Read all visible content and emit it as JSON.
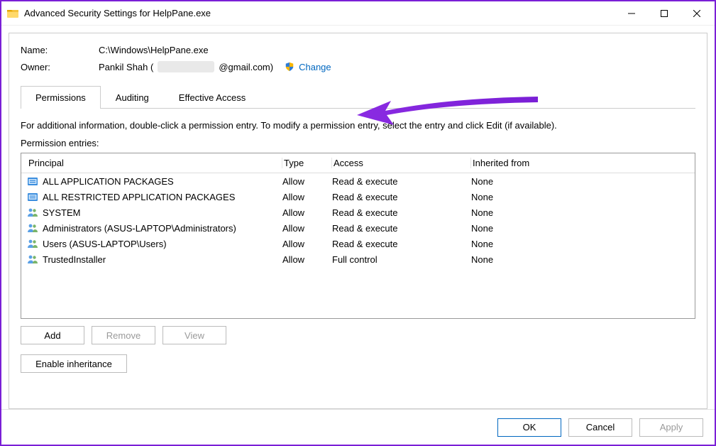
{
  "window": {
    "title": "Advanced Security Settings for HelpPane.exe"
  },
  "header": {
    "name_label": "Name:",
    "name_value": "C:\\Windows\\HelpPane.exe",
    "owner_label": "Owner:",
    "owner_prefix": "Pankil Shah (",
    "owner_suffix": "@gmail.com)",
    "change_label": "Change"
  },
  "tabs": {
    "permissions": "Permissions",
    "auditing": "Auditing",
    "effective": "Effective Access"
  },
  "info_text": "For additional information, double-click a permission entry. To modify a permission entry, select the entry and click Edit (if available).",
  "entries_label": "Permission entries:",
  "columns": {
    "principal": "Principal",
    "type": "Type",
    "access": "Access",
    "inherited": "Inherited from"
  },
  "rows": [
    {
      "icon": "pkg",
      "principal": "ALL APPLICATION PACKAGES",
      "type": "Allow",
      "access": "Read & execute",
      "inherited": "None"
    },
    {
      "icon": "pkg",
      "principal": "ALL RESTRICTED APPLICATION PACKAGES",
      "type": "Allow",
      "access": "Read & execute",
      "inherited": "None"
    },
    {
      "icon": "grp",
      "principal": "SYSTEM",
      "type": "Allow",
      "access": "Read & execute",
      "inherited": "None"
    },
    {
      "icon": "grp",
      "principal": "Administrators (ASUS-LAPTOP\\Administrators)",
      "type": "Allow",
      "access": "Read & execute",
      "inherited": "None"
    },
    {
      "icon": "grp",
      "principal": "Users (ASUS-LAPTOP\\Users)",
      "type": "Allow",
      "access": "Read & execute",
      "inherited": "None"
    },
    {
      "icon": "grp",
      "principal": "TrustedInstaller",
      "type": "Allow",
      "access": "Full control",
      "inherited": "None"
    }
  ],
  "buttons": {
    "add": "Add",
    "remove": "Remove",
    "view": "View",
    "enable_inheritance": "Enable inheritance",
    "ok": "OK",
    "cancel": "Cancel",
    "apply": "Apply"
  }
}
